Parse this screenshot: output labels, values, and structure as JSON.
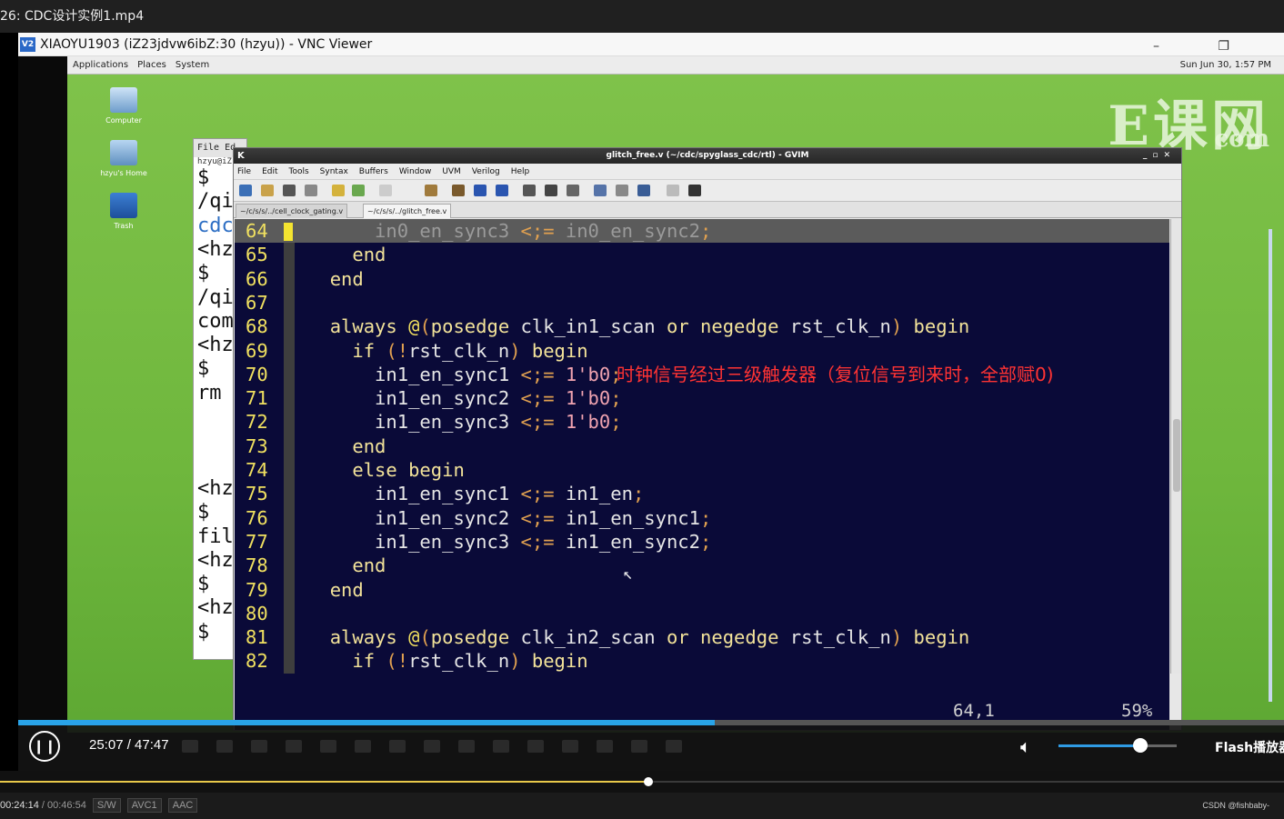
{
  "player": {
    "title": "26:  CDC设计实例1.mp4",
    "time": "25:07 / 47:47",
    "progress": 0.55,
    "volume": 0.69,
    "flash_label": "Flash播放器"
  },
  "vnc": {
    "title": "XIAOYU1903 (iZ23jdvw6ibZ:30 (hzyu)) - VNC Viewer",
    "logo": "V2",
    "controls": "–  ❐"
  },
  "gnome": {
    "menu": [
      "Applications",
      "Places",
      "System"
    ],
    "clock": "Sun Jun 30,  1:57 PM"
  },
  "desktop": {
    "brand_main": "E课网",
    "brand_com": "com",
    "icons": [
      "Computer",
      "hzyu's Home",
      "Trash"
    ]
  },
  "terminal": {
    "menu": "File  Ed",
    "host": "hzyu@iZ",
    "lines": [
      "$",
      "/qi",
      "cdc",
      "<hz",
      "$",
      "/qi",
      "com",
      "<hz",
      "$",
      "rm",
      "",
      "",
      "",
      "<hz",
      "$",
      "fil",
      "<hz",
      "$",
      "<hz",
      "$"
    ]
  },
  "gvim": {
    "title": "glitch_free.v (~/cdc/spyglass_cdc/rtl) - GVIM",
    "menu": [
      "File",
      "Edit",
      "Tools",
      "Syntax",
      "Buffers",
      "Window",
      "UVM",
      "Verilog",
      "Help"
    ],
    "tabs": [
      "~/c/s/s/../cell_clock_gating.v",
      "~/c/s/s/../glitch_free.v"
    ],
    "status_pos": "64,1",
    "status_pct": "59%",
    "annotation": "时钟信号经过三级触发器（复位信号到来时，全部赋0)"
  },
  "code_lines": [
    {
      "n": "64",
      "t": "      in0_en_sync3 <= in0_en_sync2;"
    },
    {
      "n": "65",
      "t": "    end"
    },
    {
      "n": "66",
      "t": "  end"
    },
    {
      "n": "67",
      "t": ""
    },
    {
      "n": "68",
      "t": "  always @(posedge clk_in1_scan or negedge rst_clk_n) begin"
    },
    {
      "n": "69",
      "t": "    if (!rst_clk_n) begin"
    },
    {
      "n": "70",
      "t": "      in1_en_sync1 <= 1'b0;"
    },
    {
      "n": "71",
      "t": "      in1_en_sync2 <= 1'b0;"
    },
    {
      "n": "72",
      "t": "      in1_en_sync3 <= 1'b0;"
    },
    {
      "n": "73",
      "t": "    end"
    },
    {
      "n": "74",
      "t": "    else begin"
    },
    {
      "n": "75",
      "t": "      in1_en_sync1 <= in1_en;"
    },
    {
      "n": "76",
      "t": "      in1_en_sync2 <= in1_en_sync1;"
    },
    {
      "n": "77",
      "t": "      in1_en_sync3 <= in1_en_sync2;"
    },
    {
      "n": "78",
      "t": "    end"
    },
    {
      "n": "79",
      "t": "  end"
    },
    {
      "n": "80",
      "t": ""
    },
    {
      "n": "81",
      "t": "  always @(posedge clk_in2_scan or negedge rst_clk_n) begin"
    },
    {
      "n": "82",
      "t": "    if (!rst_clk_n) begin"
    }
  ],
  "outer": {
    "progress": 0.505,
    "current": "00:24:14",
    "total": "00:46:54",
    "tags": [
      "S/W",
      "AVC1",
      "AAC"
    ],
    "watermark": "CSDN @fishbaby-"
  },
  "colors": {
    "accent": "#29a3e8",
    "editor_bg": "#0a0a38",
    "desktop": "#6fb73d",
    "annotation": "#ff3333"
  }
}
